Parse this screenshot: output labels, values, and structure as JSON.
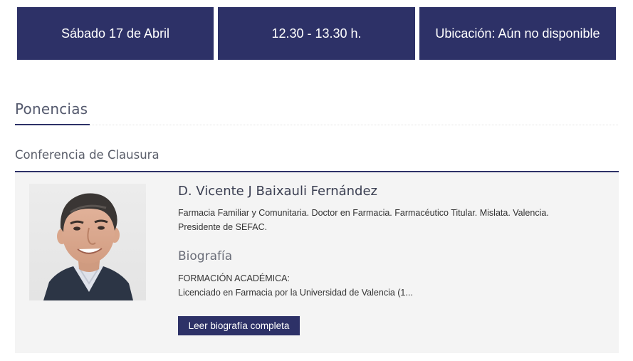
{
  "event_info": {
    "date": "Sábado 17 de Abril",
    "time": "12.30 - 13.30 h.",
    "location": "Ubicación: Aún no disponible"
  },
  "section": {
    "title": "Ponencias"
  },
  "session": {
    "title": "Conferencia de Clausura"
  },
  "speaker": {
    "name": "D. Vicente J Baixauli Fernández",
    "role_line1": "Farmacia Familiar y Comunitaria. Doctor en Farmacia. Farmacéutico Titular. Mislata. Valencia.",
    "role_line2": "Presidente de SEFAC.",
    "photo_alt": "D. Vicente J Baixauli Fernández",
    "bio_heading": "Biografía",
    "bio_line1": "FORMACIÓN ACADÉMICA:",
    "bio_line2": "Licenciado en Farmacia por la Universidad de Valencia (1...",
    "read_more_label": "Leer biografía completa"
  },
  "colors": {
    "brand_navy": "#2d3167",
    "card_background": "#f4f4f4",
    "heading_text": "#555a6e"
  }
}
